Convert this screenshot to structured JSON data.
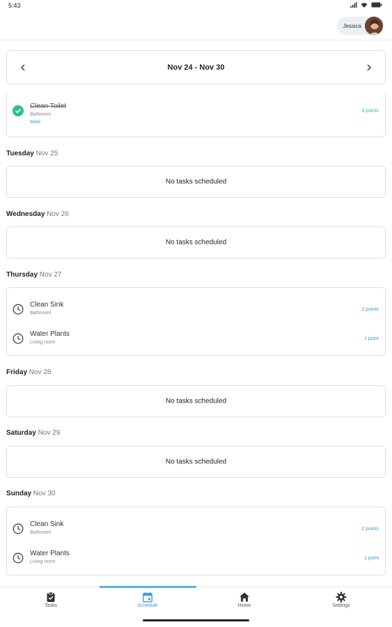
{
  "status_bar": {
    "time": "5:43"
  },
  "user": {
    "name": "Jessica"
  },
  "week": {
    "label": "Nov 24 - Nov 30"
  },
  "partial_task": {
    "title": "Clean Toilet",
    "room": "Bathroom",
    "assignee": "Mark",
    "points": "3 points",
    "done": true
  },
  "empty_text": "No tasks scheduled",
  "days": [
    {
      "name": "Tuesday",
      "date": "Nov 25"
    },
    {
      "name": "Wednesday",
      "date": "Nov 26"
    },
    {
      "name": "Thursday",
      "date": "Nov 27",
      "tasks": [
        {
          "title": "Clean Sink",
          "room": "Bathroom",
          "points": "2 points"
        },
        {
          "title": "Water Plants",
          "room": "Living room",
          "points": "1 point"
        }
      ]
    },
    {
      "name": "Friday",
      "date": "Nov 28"
    },
    {
      "name": "Saturday",
      "date": "Nov 29"
    },
    {
      "name": "Sunday",
      "date": "Nov 30",
      "tasks": [
        {
          "title": "Clean Sink",
          "room": "Bathroom",
          "points": "2 points"
        },
        {
          "title": "Water Plants",
          "room": "Living room",
          "points": "1 point"
        }
      ]
    }
  ],
  "bottom_nav": [
    {
      "label": "Tasks",
      "icon": "clipboard-check-icon"
    },
    {
      "label": "Schedule",
      "icon": "calendar-icon",
      "active": true
    },
    {
      "label": "Home",
      "icon": "house-icon"
    },
    {
      "label": "Settings",
      "icon": "gear-icon"
    }
  ],
  "colors": {
    "accent": "#3a9ed4",
    "done": "#2fbf8a",
    "border": "#dde0e3"
  }
}
